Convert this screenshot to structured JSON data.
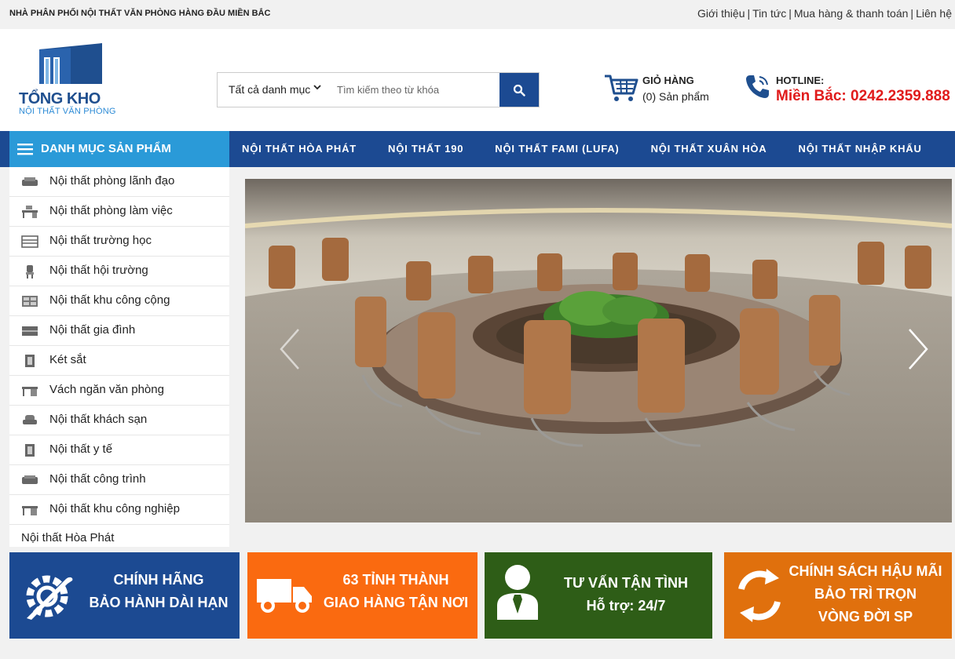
{
  "topbar": {
    "tagline": "NHÀ PHÂN PHỐI NỘI THẤT VĂN PHÒNG HÀNG ĐẦU MIỀN BẮC",
    "links": [
      "Giới thiệu",
      "Tin tức",
      "Mua hàng & thanh toán",
      "Liên hệ"
    ]
  },
  "logo": {
    "title": "TỔNG KHO",
    "subtitle": "NỘI THẤT VĂN PHÒNG"
  },
  "search": {
    "category_label": "Tất cả danh mục",
    "placeholder": "Tìm kiếm theo từ khóa"
  },
  "cart": {
    "title": "GIỎ HÀNG",
    "count_text": "(0) Sản phẩm"
  },
  "hotline": {
    "title": "HOTLINE:",
    "number": "Miền Bắc: 0242.2359.888"
  },
  "nav": {
    "category_menu": "DANH MỤC SẢN PHẨM",
    "items": [
      "NỘI THẤT HÒA PHÁT",
      "NỘI THẤT 190",
      "NỘI THẤT FAMI (LUFA)",
      "NỘI THẤT XUÂN HÒA",
      "NỘI THẤT NHẬP KHẨU"
    ]
  },
  "sidebar": {
    "items": [
      {
        "label": "Nội thất phòng lãnh đạo",
        "icon": "sofa-icon"
      },
      {
        "label": "Nội thất phòng làm việc",
        "icon": "office-desk-icon"
      },
      {
        "label": "Nội thất trường học",
        "icon": "school-desk-icon"
      },
      {
        "label": "Nội thất hội trường",
        "icon": "chair-icon"
      },
      {
        "label": "Nội thất khu công cộng",
        "icon": "public-seating-icon"
      },
      {
        "label": "Nội thất gia đình",
        "icon": "cabinet-icon"
      },
      {
        "label": "Két sắt",
        "icon": "safe-icon"
      },
      {
        "label": "Vách ngăn văn phòng",
        "icon": "partition-icon"
      },
      {
        "label": "Nội thất khách sạn",
        "icon": "armchair-icon"
      },
      {
        "label": "Nội thất y tế",
        "icon": "medical-cabinet-icon"
      },
      {
        "label": "Nội thất công trình",
        "icon": "couch-icon"
      },
      {
        "label": "Nội thất khu công nghiệp",
        "icon": "workbench-icon"
      }
    ],
    "last_item": "Nội thất Hòa Phát"
  },
  "features": [
    {
      "lines": [
        "CHÍNH HÃNG",
        "BẢO HÀNH DÀI HẠN"
      ],
      "icon": "gear-wrench-icon"
    },
    {
      "lines": [
        "63 TỈNH THÀNH",
        "GIAO HÀNG TẬN NƠI"
      ],
      "icon": "truck-icon"
    },
    {
      "lines": [
        "TƯ VẤN TẬN TÌNH",
        "Hỗ trợ: 24/7"
      ],
      "icon": "consultant-icon"
    },
    {
      "lines": [
        "CHÍNH SÁCH HẬU MÃI",
        "BẢO TRÌ TRỌN",
        "VÒNG ĐỜI SP"
      ],
      "icon": "cycle-arrows-icon"
    }
  ]
}
